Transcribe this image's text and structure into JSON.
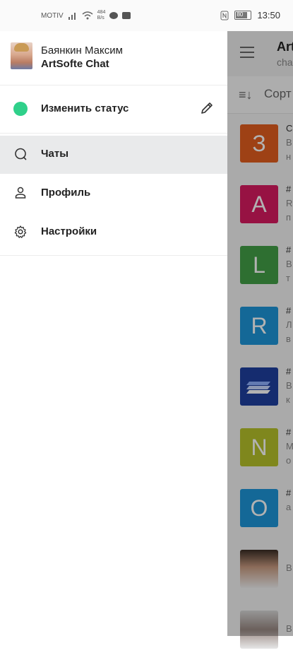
{
  "statusbar": {
    "carrier": "MOTIV",
    "net_speed_top": "484",
    "net_speed_bottom": "B/s",
    "battery_level": "80",
    "time": "13:50"
  },
  "background_app": {
    "title": "Art",
    "subtitle": "cha",
    "sort_label": "Сорт",
    "chats": [
      {
        "letter": "З",
        "color": "#e35d1f",
        "line1": "С",
        "line2": "В",
        "line3": "н"
      },
      {
        "letter": "A",
        "color": "#d81b60",
        "line1": "#",
        "line2": "R",
        "line3": "п"
      },
      {
        "letter": "L",
        "color": "#43a047",
        "line1": "#",
        "line2": "В",
        "line3": "т"
      },
      {
        "letter": "R",
        "color": "#1e96d8",
        "line1": "#",
        "line2": "Л",
        "line3": "в"
      },
      {
        "letter": "",
        "color": "#1f3f9f",
        "line1": "#",
        "line2": "В",
        "line3": "к"
      },
      {
        "letter": "N",
        "color": "#b6c22a",
        "line1": "#",
        "line2": "М",
        "line3": "о"
      },
      {
        "letter": "O",
        "color": "#1e96d8",
        "line1": "#",
        "line2": "а",
        "line3": ""
      },
      {
        "letter": "",
        "color": "#5a4a42",
        "line1": "",
        "line2": "В",
        "line3": ""
      },
      {
        "letter": "",
        "color": "#8c8c8c",
        "line1": "",
        "line2": "В",
        "line3": ""
      }
    ]
  },
  "drawer": {
    "user_name": "Баянкин Максим",
    "app_name": "ArtSofte Chat",
    "status_label": "Изменить статус",
    "status_color": "#2fd08a",
    "menu": [
      {
        "label": "Чаты",
        "icon": "chat-bubble-icon",
        "active": true
      },
      {
        "label": "Профиль",
        "icon": "person-icon",
        "active": false
      },
      {
        "label": "Настройки",
        "icon": "gear-icon",
        "active": false
      }
    ]
  }
}
